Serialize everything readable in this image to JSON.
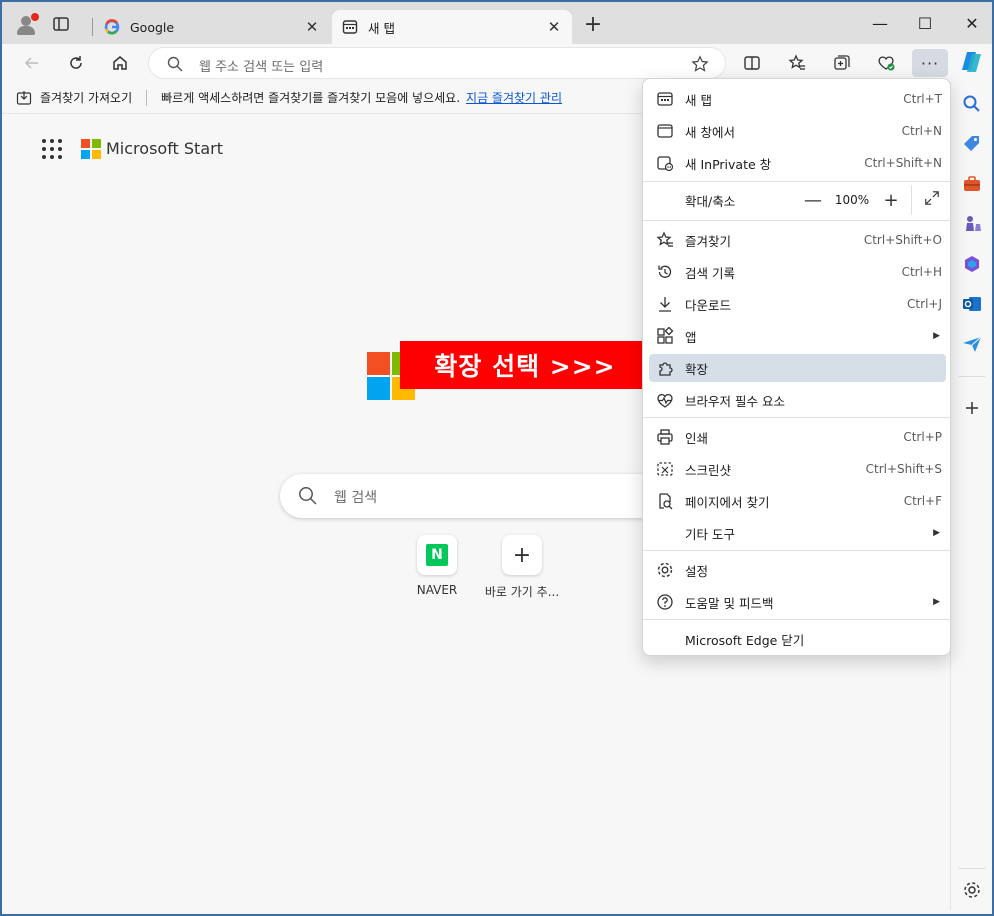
{
  "tabs": [
    {
      "title": "Google",
      "favicon": "google-icon"
    },
    {
      "title": "새 탭",
      "favicon": "newtab-icon"
    }
  ],
  "address_bar": {
    "placeholder": "웹 주소 검색 또는 입력"
  },
  "favorites_bar": {
    "import_label": "즐겨찾기 가져오기",
    "hint": "빠르게 액세스하려면 즐겨찾기를 즐겨찾기 모음에 넣으세요.",
    "manage_link": "지금 즐겨찾기 관리"
  },
  "start": {
    "brand": "Microsoft Start",
    "banner": "확장 선택 >>>",
    "search_placeholder": "웹 검색"
  },
  "quick_links": [
    {
      "label": "NAVER",
      "icon": "naver-icon",
      "glyph": "N"
    },
    {
      "label": "바로 가기 추...",
      "icon": "plus-icon",
      "glyph": "+"
    }
  ],
  "menu": {
    "items": [
      {
        "label": "새 탭",
        "shortcut": "Ctrl+T",
        "icon": "new-tab-icon"
      },
      {
        "label": "새 창에서",
        "shortcut": "Ctrl+N",
        "icon": "new-window-icon"
      },
      {
        "label": "새 InPrivate 창",
        "shortcut": "Ctrl+Shift+N",
        "icon": "inprivate-icon"
      },
      {
        "label": "즐겨찾기",
        "shortcut": "Ctrl+Shift+O",
        "icon": "favorites-icon"
      },
      {
        "label": "검색 기록",
        "shortcut": "Ctrl+H",
        "icon": "history-icon"
      },
      {
        "label": "다운로드",
        "shortcut": "Ctrl+J",
        "icon": "download-icon"
      },
      {
        "label": "앱",
        "shortcut": "",
        "icon": "apps-icon"
      },
      {
        "label": "확장",
        "shortcut": "",
        "icon": "extensions-icon"
      },
      {
        "label": "브라우저 필수 요소",
        "shortcut": "",
        "icon": "essentials-icon"
      },
      {
        "label": "인쇄",
        "shortcut": "Ctrl+P",
        "icon": "print-icon"
      },
      {
        "label": "스크린샷",
        "shortcut": "Ctrl+Shift+S",
        "icon": "screenshot-icon"
      },
      {
        "label": "페이지에서 찾기",
        "shortcut": "Ctrl+F",
        "icon": "find-icon"
      },
      {
        "label": "기타 도구",
        "shortcut": "",
        "icon": ""
      },
      {
        "label": "설정",
        "shortcut": "",
        "icon": "settings-icon"
      },
      {
        "label": "도움말 및 피드백",
        "shortcut": "",
        "icon": "help-icon"
      },
      {
        "label": "Microsoft Edge 닫기",
        "shortcut": "",
        "icon": ""
      }
    ],
    "zoom": {
      "label": "확대/축소",
      "value": "100%",
      "minus": "—",
      "plus": "+"
    }
  },
  "colors": {
    "ms_red": "#f25022",
    "ms_green": "#7fba00",
    "ms_blue": "#00a4ef",
    "ms_yellow": "#ffb900",
    "banner": "#ff0000",
    "highlight": "#d6dfe8"
  }
}
